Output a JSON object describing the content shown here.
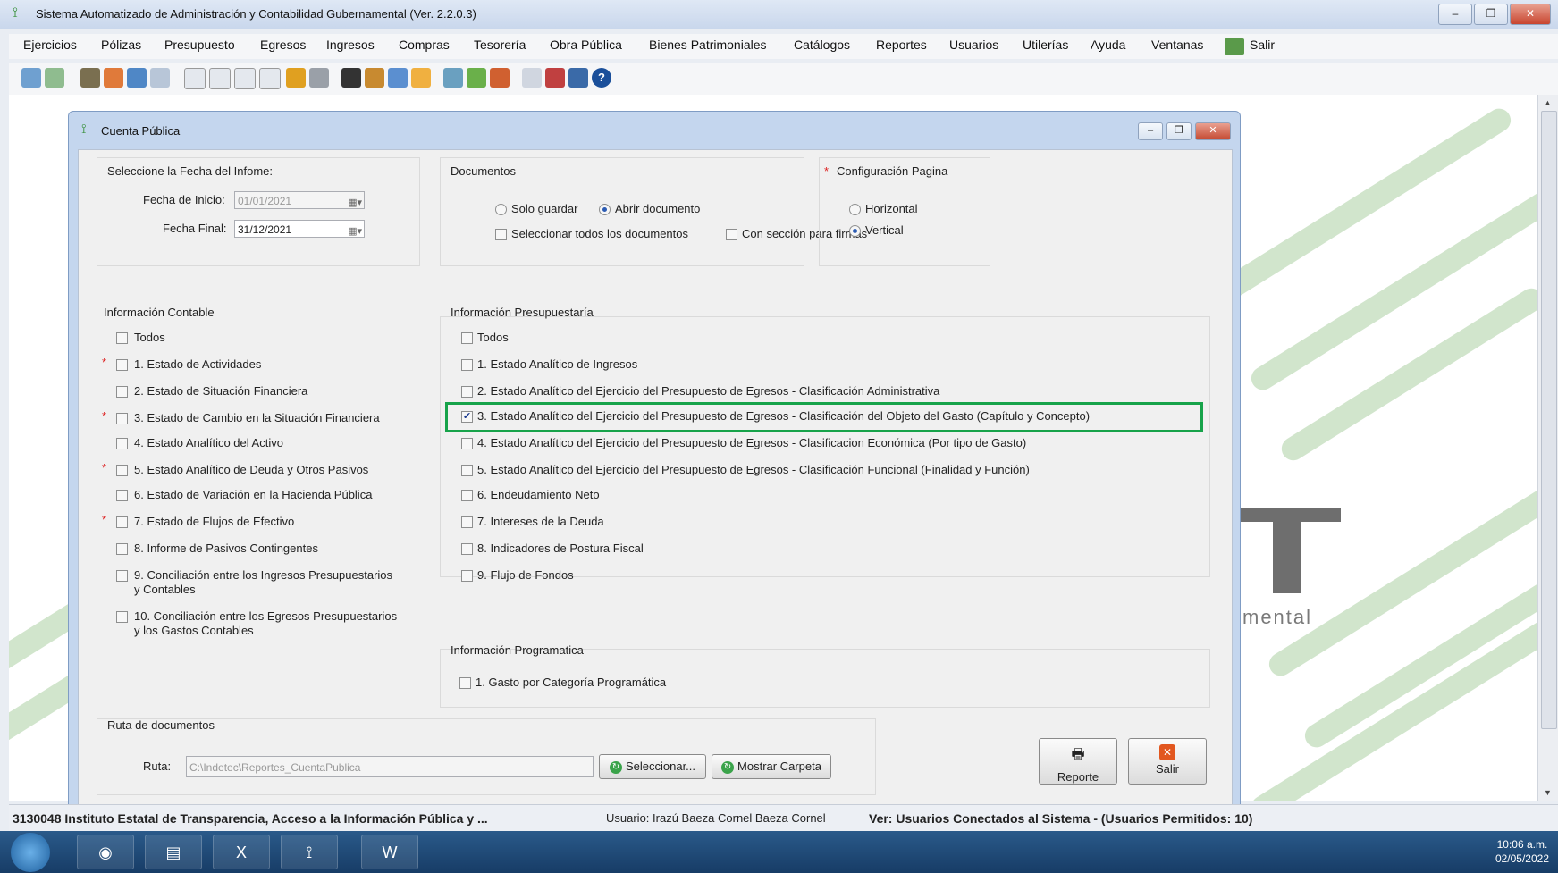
{
  "app": {
    "title": "Sistema Automatizado de Administración y Contabilidad Gubernamental (Ver. 2.2.0.3)",
    "logo_text_fragment": "mental"
  },
  "menu": [
    "Ejercicios",
    "Pólizas",
    "Presupuesto",
    "Egresos",
    "Ingresos",
    "Compras",
    "Tesorería",
    "Obra Pública",
    "Bienes Patrimoniales",
    "Catálogos",
    "Reportes",
    "Usuarios",
    "Utilerías",
    "Ayuda",
    "Ventanas",
    "Salir"
  ],
  "dialog": {
    "title": "Cuenta Pública",
    "fecha": {
      "group_label": "Seleccione la Fecha del Infome:",
      "inicio_label": "Fecha de Inicio:",
      "inicio_value": "01/01/2021",
      "final_label": "Fecha Final:",
      "final_value": "31/12/2021"
    },
    "documentos": {
      "group_label": "Documentos",
      "solo_guardar": "Solo guardar",
      "abrir_documento": "Abrir documento",
      "seleccionar_todos": "Seleccionar todos los documentos",
      "con_seccion_firmas": "Con sección para firmas"
    },
    "config": {
      "group_label": "Configuración Pagina",
      "horizontal": "Horizontal",
      "vertical": "Vertical"
    },
    "contable": {
      "group_label": "Información Contable",
      "items": [
        {
          "label": "Todos",
          "required": false
        },
        {
          "label": "1. Estado de Actividades",
          "required": true
        },
        {
          "label": "2. Estado de Situación Financiera",
          "required": false
        },
        {
          "label": "3. Estado de Cambio en la Situación Financiera",
          "required": true
        },
        {
          "label": "4. Estado Analítico del Activo",
          "required": false
        },
        {
          "label": "5. Estado Analítico de Deuda y Otros Pasivos",
          "required": true
        },
        {
          "label": "6. Estado de Variación en la Hacienda Pública",
          "required": false
        },
        {
          "label": "7. Estado de Flujos de Efectivo",
          "required": true
        },
        {
          "label": "8. Informe de Pasivos Contingentes",
          "required": false
        },
        {
          "label": "9. Conciliación entre los Ingresos Presupuestarios",
          "label2": "y Contables",
          "required": false
        },
        {
          "label": "10. Conciliación entre los Egresos Presupuestarios",
          "label2": "y los Gastos Contables",
          "required": false
        }
      ]
    },
    "presupuestaria": {
      "group_label": "Información Presupuestaría",
      "items": [
        {
          "label": "Todos",
          "checked": false
        },
        {
          "label": "1. Estado Analítico de Ingresos",
          "checked": false
        },
        {
          "label": "2. Estado Analítico del Ejercicio del Presupuesto de Egresos - Clasificación Administrativa",
          "checked": false
        },
        {
          "label": "3. Estado Analítico del Ejercicio del Presupuesto de Egresos - Clasificación del Objeto del Gasto (Capítulo y Concepto)",
          "checked": true
        },
        {
          "label": "4. Estado Analítico del Ejercicio del Presupuesto de Egresos - Clasificacion Económica (Por tipo de Gasto)",
          "checked": false
        },
        {
          "label": "5. Estado Analítico del Ejercicio del Presupuesto de Egresos - Clasificación Funcional (Finalidad y Función)",
          "checked": false
        },
        {
          "label": "6. Endeudamiento Neto",
          "checked": false
        },
        {
          "label": "7. Intereses de la Deuda",
          "checked": false
        },
        {
          "label": "8. Indicadores de Postura Fiscal",
          "checked": false
        },
        {
          "label": "9. Flujo de Fondos",
          "checked": false
        }
      ]
    },
    "programatica": {
      "group_label": "Información Programatica",
      "item": "1. Gasto por Categoría Programática"
    },
    "ruta": {
      "group_label": "Ruta de documentos",
      "label": "Ruta:",
      "value": "C:\\Indetec\\Reportes_CuentaPublica",
      "seleccionar": "Seleccionar...",
      "mostrar_carpeta": "Mostrar Carpeta"
    },
    "buttons": {
      "reporte": "Reporte",
      "salir": "Salir"
    }
  },
  "status": {
    "entity": "3130048 Instituto Estatal de Transparencia, Acceso a la Información Pública y ...",
    "user": "Usuario: Irazú Baeza Cornel Baeza Cornel",
    "connected": "Ver: Usuarios Conectados al Sistema - (Usuarios Permitidos: 10)"
  },
  "taskbar": {
    "time": "10:06 a.m.",
    "date": "02/05/2022"
  }
}
